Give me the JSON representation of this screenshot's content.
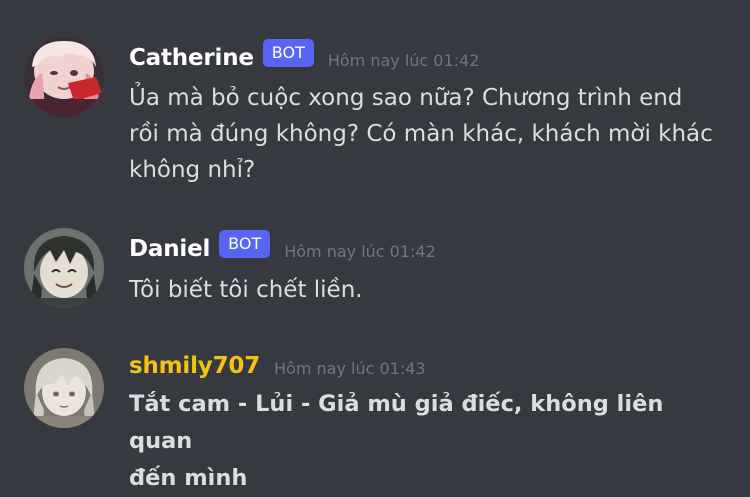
{
  "messages": [
    {
      "author": "Catherine",
      "author_color": "#ffffff",
      "badge": "BOT",
      "timestamp": "Hôm nay lúc 01:42",
      "text": "Ủa mà bỏ cuộc xong sao nữa? Chương trình end\nrồi mà đúng không? Có màn khác, khách mời khác\nkhông nhỉ?",
      "avatar_icon": "pink-hair-anime-avatar"
    },
    {
      "author": "Daniel",
      "author_color": "#ffffff",
      "badge": "BOT",
      "timestamp": "Hôm nay lúc 01:42",
      "text": "Tôi biết tôi chết liền.",
      "avatar_icon": "dark-hair-anime-avatar"
    },
    {
      "author": "shmily707",
      "author_color": "#f1c40f",
      "timestamp": "Hôm nay lúc 01:43",
      "text": "Tắt cam - Lủi - Giả mù giả điếc, không liên quan\nđến mình",
      "avatar_icon": "silver-hair-anime-avatar"
    }
  ],
  "colors": {
    "background": "#36393f",
    "bot_badge": "#5865f2",
    "timestamp": "#72767d",
    "message_text": "#dcddde"
  }
}
